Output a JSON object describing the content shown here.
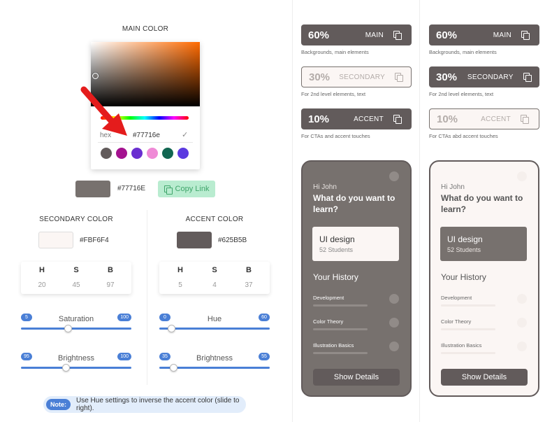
{
  "main_color": {
    "title": "MAIN COLOR",
    "hex_label": "hex",
    "hex_value": "#77716e",
    "confirm_icon": "check-icon",
    "presets": [
      "#625b5b",
      "#a4128f",
      "#6a2fd0",
      "#ef8ad6",
      "#116651",
      "#5b3ae0"
    ],
    "gradient_hue": "#ff6a00",
    "swatch_color": "#77716E",
    "display_hex": "#77716E",
    "copy_label": "Copy Link",
    "copy_icon": "copy-icon"
  },
  "secondary": {
    "title": "SECONDARY COLOR",
    "color": "#FBF6F4",
    "hex": "#FBF6F4",
    "h_label": "H",
    "s_label": "S",
    "b_label": "B",
    "h": "20",
    "s": "45",
    "b": "97",
    "slider1": {
      "label": "Saturation",
      "min": "5",
      "max": "100",
      "value": 45
    },
    "slider2": {
      "label": "Brightness",
      "min": "95",
      "max": "100",
      "value": 97
    }
  },
  "accent": {
    "title": "ACCENT COLOR",
    "color": "#625B5B",
    "hex": "#625B5B",
    "h_label": "H",
    "s_label": "S",
    "b_label": "B",
    "h": "5",
    "s": "4",
    "b": "37",
    "slider1": {
      "label": "Hue",
      "min": "0",
      "max": "60",
      "value": 5
    },
    "slider2": {
      "label": "Brightness",
      "min": "35",
      "max": "55",
      "value": 37
    }
  },
  "note": {
    "tag": "Note:",
    "text": "Use Hue settings to inverse the accent color (slide to right)."
  },
  "preview_dark": {
    "roles": [
      {
        "pct": "60%",
        "name": "MAIN",
        "caption": "Backgrounds, main elements"
      },
      {
        "pct": "30%",
        "name": "SECONDARY",
        "caption": "For 2nd level elements, text"
      },
      {
        "pct": "10%",
        "name": "ACCENT",
        "caption": "For CTAs and accent touches"
      }
    ],
    "phone": {
      "greeting": "Hi John",
      "question": "What do you want to learn?",
      "course_title": "UI design",
      "course_sub": "52 Students",
      "history_title": "Your History",
      "items": [
        "Development",
        "Color Theory",
        "Illustration Basics"
      ],
      "button": "Show Details"
    }
  },
  "preview_light": {
    "roles": [
      {
        "pct": "60%",
        "name": "MAIN",
        "caption": "Backgrounds, main elements"
      },
      {
        "pct": "30%",
        "name": "SECONDARY",
        "caption": "For 2nd level elements, text"
      },
      {
        "pct": "10%",
        "name": "ACCENT",
        "caption": "For CTAs abd accent touches"
      }
    ],
    "phone": {
      "greeting": "Hi John",
      "question": "What do you want to learn?",
      "course_title": "UI design",
      "course_sub": "52 Students",
      "history_title": "Your History",
      "items": [
        "Development",
        "Color Theory",
        "Illustration Basics"
      ],
      "button": "Show Details"
    }
  }
}
